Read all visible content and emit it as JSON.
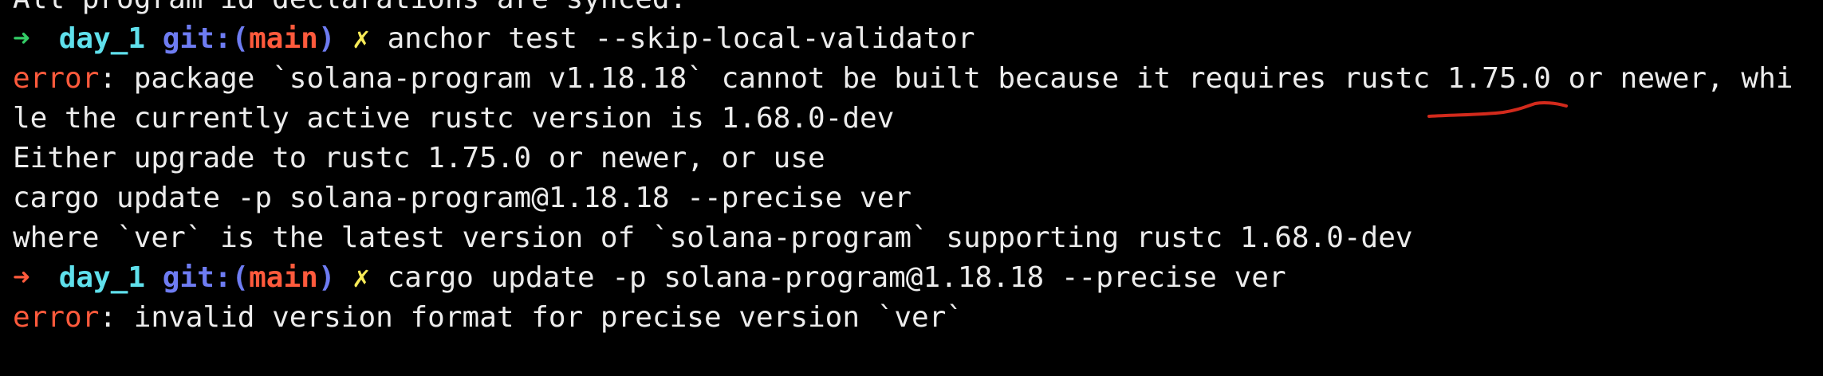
{
  "colors": {
    "background": "#000000",
    "text": "#ececec",
    "prompt_arrow_success": "#33cc66",
    "prompt_arrow_failure": "#ff5a3c",
    "directory": "#5fe0ec",
    "git_label": "#6e7cf2",
    "branch": "#ff5a3c",
    "dirty_marker": "#f6ea57",
    "error_label": "#ff5a3c",
    "annotation": "#d22a1c"
  },
  "lines": [
    {
      "kind": "output",
      "text": "All program id declarations are synced."
    },
    {
      "kind": "prompt",
      "arrow": "➜",
      "status": "success",
      "dir": "day_1",
      "git_label": "git:(",
      "branch": "main",
      "git_close": ")",
      "dirty": "✗",
      "command": "anchor test --skip-local-validator"
    },
    {
      "kind": "error",
      "label": "error",
      "text": ": package `solana-program v1.18.18` cannot be built because it requires rustc 1.75.0 or newer, whi"
    },
    {
      "kind": "output",
      "text": "le the currently active rustc version is 1.68.0-dev"
    },
    {
      "kind": "output",
      "text": "Either upgrade to rustc 1.75.0 or newer, or use"
    },
    {
      "kind": "output",
      "text": "cargo update -p solana-program@1.18.18 --precise ver"
    },
    {
      "kind": "output",
      "text": "where `ver` is the latest version of `solana-program` supporting rustc 1.68.0-dev"
    },
    {
      "kind": "prompt",
      "arrow": "➜",
      "status": "failure",
      "dir": "day_1",
      "git_label": "git:(",
      "branch": "main",
      "git_close": ")",
      "dirty": "✗",
      "command": "cargo update -p solana-program@1.18.18 --precise ver"
    },
    {
      "kind": "error",
      "label": "error",
      "text": ": invalid version format for precise version `ver`"
    }
  ]
}
